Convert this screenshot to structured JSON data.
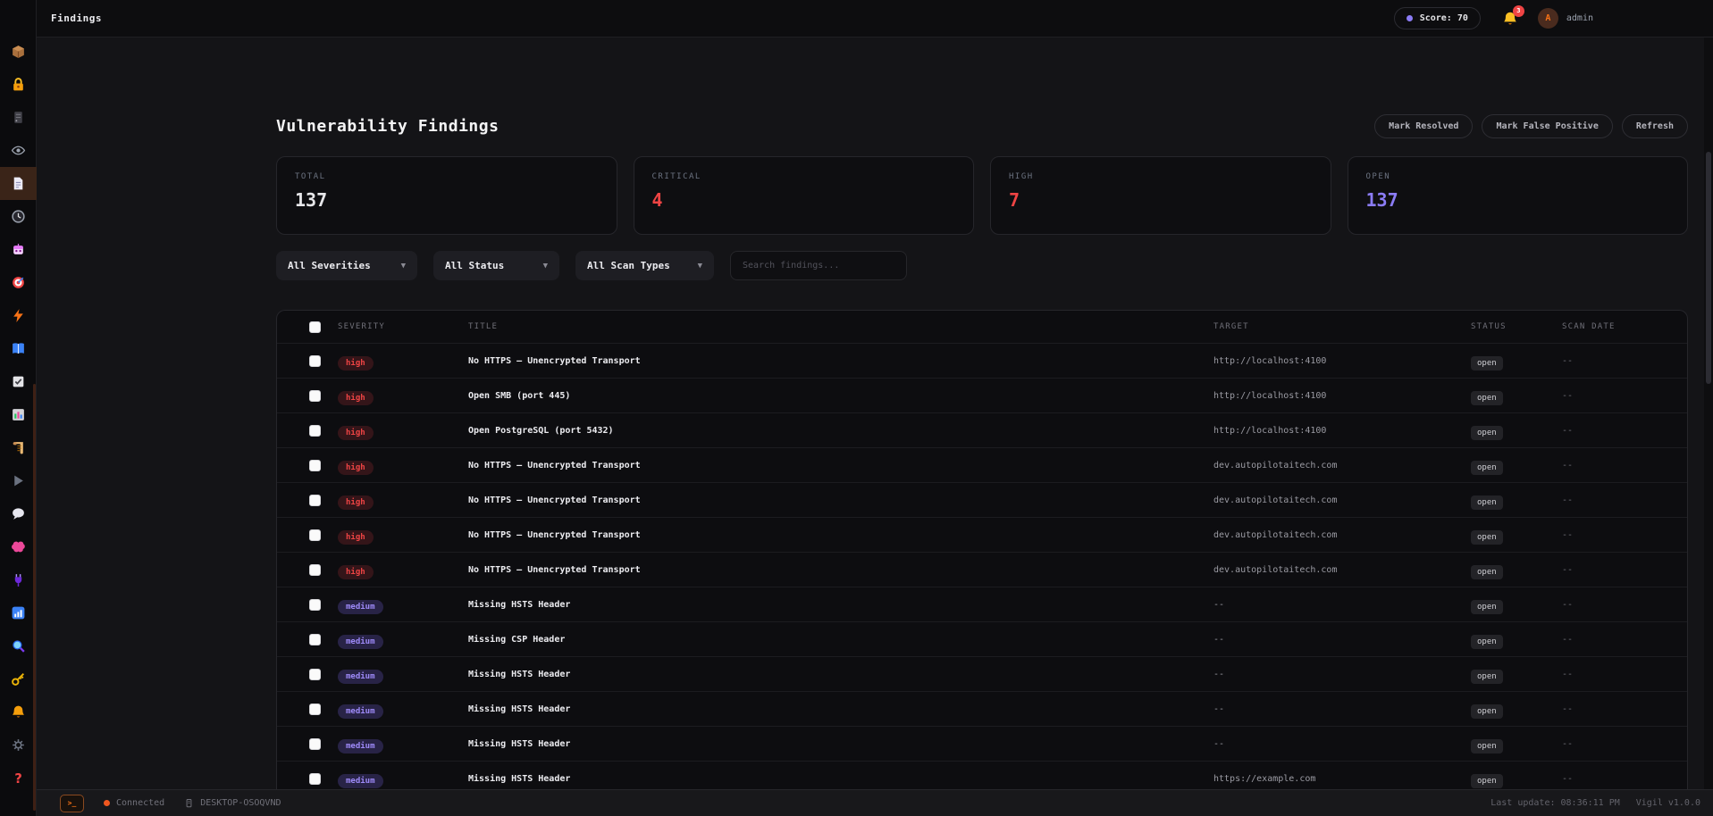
{
  "topbar": {
    "title": "Findings",
    "score_label": "Score: 70",
    "notification_count": "3",
    "avatar_initial": "A",
    "username": "admin",
    "score_accent": "#8b7cf6"
  },
  "sidebar": {
    "items": [
      {
        "name": "package"
      },
      {
        "name": "lock"
      },
      {
        "name": "server"
      },
      {
        "name": "eye"
      },
      {
        "name": "document",
        "active": true
      },
      {
        "name": "clock"
      },
      {
        "name": "robot"
      },
      {
        "name": "target"
      },
      {
        "name": "lightning"
      },
      {
        "name": "book"
      },
      {
        "name": "checkbox"
      },
      {
        "name": "chart"
      },
      {
        "name": "scroll"
      },
      {
        "name": "play"
      },
      {
        "name": "speech"
      },
      {
        "name": "brain"
      },
      {
        "name": "plug"
      },
      {
        "name": "stats"
      },
      {
        "name": "search"
      },
      {
        "name": "key"
      },
      {
        "name": "bell"
      },
      {
        "name": "gear"
      },
      {
        "name": "help"
      }
    ]
  },
  "page": {
    "title": "Vulnerability Findings",
    "actions": [
      "Mark Resolved",
      "Mark False Positive",
      "Refresh"
    ],
    "stats": [
      {
        "label": "TOTAL",
        "value": "137",
        "color": "#e7e7ea"
      },
      {
        "label": "CRITICAL",
        "value": "4",
        "color": "#ef4444"
      },
      {
        "label": "HIGH",
        "value": "7",
        "color": "#ef4444"
      },
      {
        "label": "OPEN",
        "value": "137",
        "color": "#8b7cf6"
      }
    ],
    "filters": {
      "severity": "All Severities",
      "status": "All Status",
      "scan_type": "All Scan Types",
      "search_placeholder": "Search findings..."
    },
    "table": {
      "columns": [
        "SEVERITY",
        "TITLE",
        "TARGET",
        "STATUS",
        "SCAN DATE"
      ],
      "rows": [
        {
          "severity": "high",
          "title": "No HTTPS — Unencrypted Transport",
          "target": "http://localhost:4100",
          "status": "open",
          "scan_date": "--"
        },
        {
          "severity": "high",
          "title": "Open SMB (port 445)",
          "target": "http://localhost:4100",
          "status": "open",
          "scan_date": "--"
        },
        {
          "severity": "high",
          "title": "Open PostgreSQL (port 5432)",
          "target": "http://localhost:4100",
          "status": "open",
          "scan_date": "--"
        },
        {
          "severity": "high",
          "title": "No HTTPS — Unencrypted Transport",
          "target": "dev.autopilotaitech.com",
          "status": "open",
          "scan_date": "--"
        },
        {
          "severity": "high",
          "title": "No HTTPS — Unencrypted Transport",
          "target": "dev.autopilotaitech.com",
          "status": "open",
          "scan_date": "--"
        },
        {
          "severity": "high",
          "title": "No HTTPS — Unencrypted Transport",
          "target": "dev.autopilotaitech.com",
          "status": "open",
          "scan_date": "--"
        },
        {
          "severity": "high",
          "title": "No HTTPS — Unencrypted Transport",
          "target": "dev.autopilotaitech.com",
          "status": "open",
          "scan_date": "--"
        },
        {
          "severity": "medium",
          "title": "Missing HSTS Header",
          "target": "--",
          "status": "open",
          "scan_date": "--"
        },
        {
          "severity": "medium",
          "title": "Missing CSP Header",
          "target": "--",
          "status": "open",
          "scan_date": "--"
        },
        {
          "severity": "medium",
          "title": "Missing HSTS Header",
          "target": "--",
          "status": "open",
          "scan_date": "--"
        },
        {
          "severity": "medium",
          "title": "Missing HSTS Header",
          "target": "--",
          "status": "open",
          "scan_date": "--"
        },
        {
          "severity": "medium",
          "title": "Missing HSTS Header",
          "target": "--",
          "status": "open",
          "scan_date": "--"
        },
        {
          "severity": "medium",
          "title": "Missing HSTS Header",
          "target": "https://example.com",
          "status": "open",
          "scan_date": "--"
        }
      ]
    }
  },
  "statusbar": {
    "terminal_glyph": ">_",
    "connection": "Connected",
    "host": "DESKTOP-OSOQVND",
    "last_update": "Last update: 08:36:11 PM",
    "version": "Vigil v1.0.0"
  }
}
